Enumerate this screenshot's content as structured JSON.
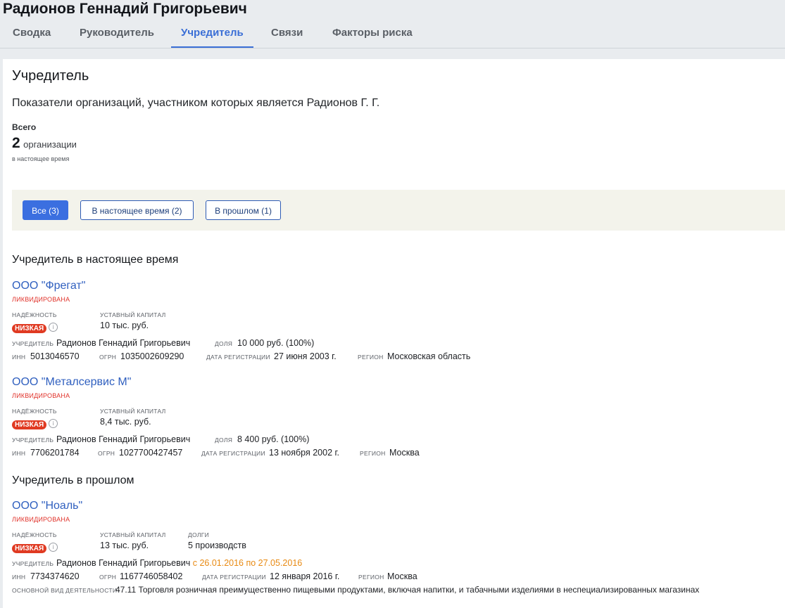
{
  "header": {
    "title": "Радионов Геннадий Григорьевич",
    "tabs": [
      {
        "label": "Сводка"
      },
      {
        "label": "Руководитель"
      },
      {
        "label": "Учредитель"
      },
      {
        "label": "Связи"
      },
      {
        "label": "Факторы риска"
      }
    ],
    "active_tab": "Учредитель"
  },
  "main": {
    "heading": "Учредитель",
    "subtitle": "Показатели организаций, участником которых является Радионов Г. Г.",
    "total": {
      "label": "Всего",
      "count": "2",
      "unit": "организации",
      "note": "в настоящее время"
    },
    "filters": [
      {
        "label": "Все (3)",
        "active": true
      },
      {
        "label": "В настоящее время (2)",
        "active": false
      },
      {
        "label": "В прошлом (1)",
        "active": false
      }
    ],
    "labels": {
      "reliability": "НАДЁЖНОСТЬ",
      "capital": "УСТАВНЫЙ КАПИТАЛ",
      "debts": "ДОЛГИ",
      "founder": "УЧРЕДИТЕЛЬ",
      "share": "ДОЛЯ",
      "inn": "ИНН",
      "ogrn": "ОГРН",
      "reg_date": "ДАТА РЕГИСТРАЦИИ",
      "region": "РЕГИОН",
      "activity": "ОСНОВНОЙ ВИД ДЕЯТЕЛЬНОСТИ"
    },
    "current_section": {
      "heading": "Учредитель в настоящее время",
      "orgs": [
        {
          "name": "ООО \"Фрегат\"",
          "status": "ЛИКВИДИРОВАНА",
          "reliability": "НИЗКАЯ",
          "capital": "10 тыс. руб.",
          "founder": "Радионов Геннадий Григорьевич",
          "share": "10 000 руб. (100%)",
          "inn": "5013046570",
          "ogrn": "1035002609290",
          "reg_date": "27 июня 2003 г.",
          "region": "Московская область"
        },
        {
          "name": "ООО \"Металсервис М\"",
          "status": "ЛИКВИДИРОВАНА",
          "reliability": "НИЗКАЯ",
          "capital": "8,4 тыс. руб.",
          "founder": "Радионов Геннадий Григорьевич",
          "share": "8 400 руб. (100%)",
          "inn": "7706201784",
          "ogrn": "1027700427457",
          "reg_date": "13 ноября 2002 г.",
          "region": "Москва"
        }
      ]
    },
    "past_section": {
      "heading": "Учредитель в прошлом",
      "orgs": [
        {
          "name": "ООО \"Ноаль\"",
          "status": "ЛИКВИДИРОВАНА",
          "reliability": "НИЗКАЯ",
          "capital": "13 тыс. руб.",
          "debts": "5 производств",
          "founder": "Радионов Геннадий Григорьевич",
          "period": "с 26.01.2016 по 27.05.2016",
          "inn": "7734374620",
          "ogrn": "1167746058402",
          "reg_date": "12 января 2016 г.",
          "region": "Москва",
          "activity": "47.11 Торговля розничная преимущественно пищевыми продуктами, включая напитки, и табачными изделиями в неспециализированных магазинах"
        }
      ]
    },
    "colors": {
      "accent": "#3b6fe0",
      "link": "#2f5fbf",
      "danger": "#e03a22",
      "period": "#e88a13"
    },
    "icons": {
      "info": "info-icon"
    }
  }
}
